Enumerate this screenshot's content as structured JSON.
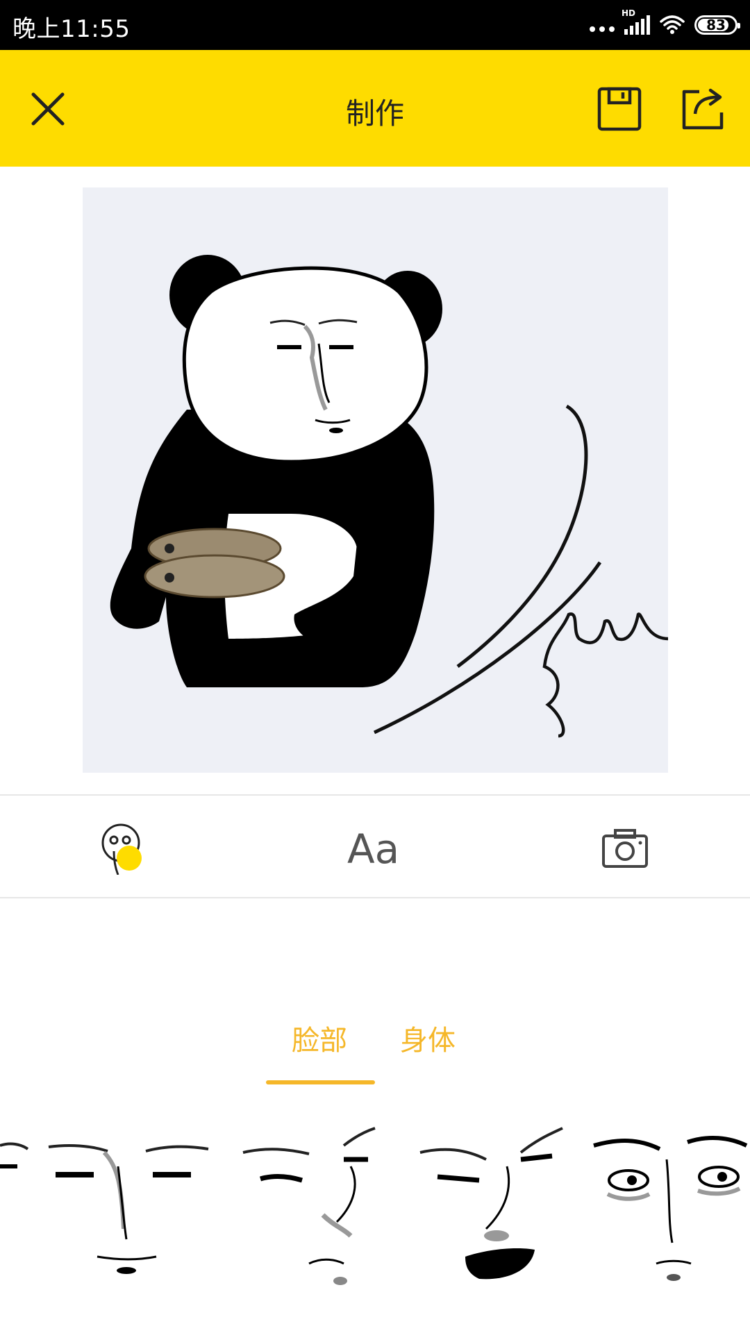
{
  "status_bar": {
    "time": "晚上11:55",
    "battery": "83",
    "network_label": "HD"
  },
  "toolbar": {
    "title": "制作",
    "close_icon": "close-icon",
    "save_icon": "save-icon",
    "share_icon": "share-icon",
    "background": "#FEDC00"
  },
  "editor": {
    "canvas_background": "#EEF0F6"
  },
  "tools": {
    "items": [
      {
        "icon": "face-sticker-icon"
      },
      {
        "icon": "text-icon",
        "label": "Aa"
      },
      {
        "icon": "camera-icon"
      }
    ]
  },
  "tabs": [
    {
      "label": "脸部",
      "active": true
    },
    {
      "label": "身体",
      "active": false
    }
  ],
  "accent_color": "#F5B729",
  "face_items": [
    {
      "icon": "face-partial-icon"
    },
    {
      "icon": "face-calm-icon"
    },
    {
      "icon": "face-side-glance-icon"
    },
    {
      "icon": "face-shout-icon"
    },
    {
      "icon": "face-tired-icon"
    }
  ]
}
